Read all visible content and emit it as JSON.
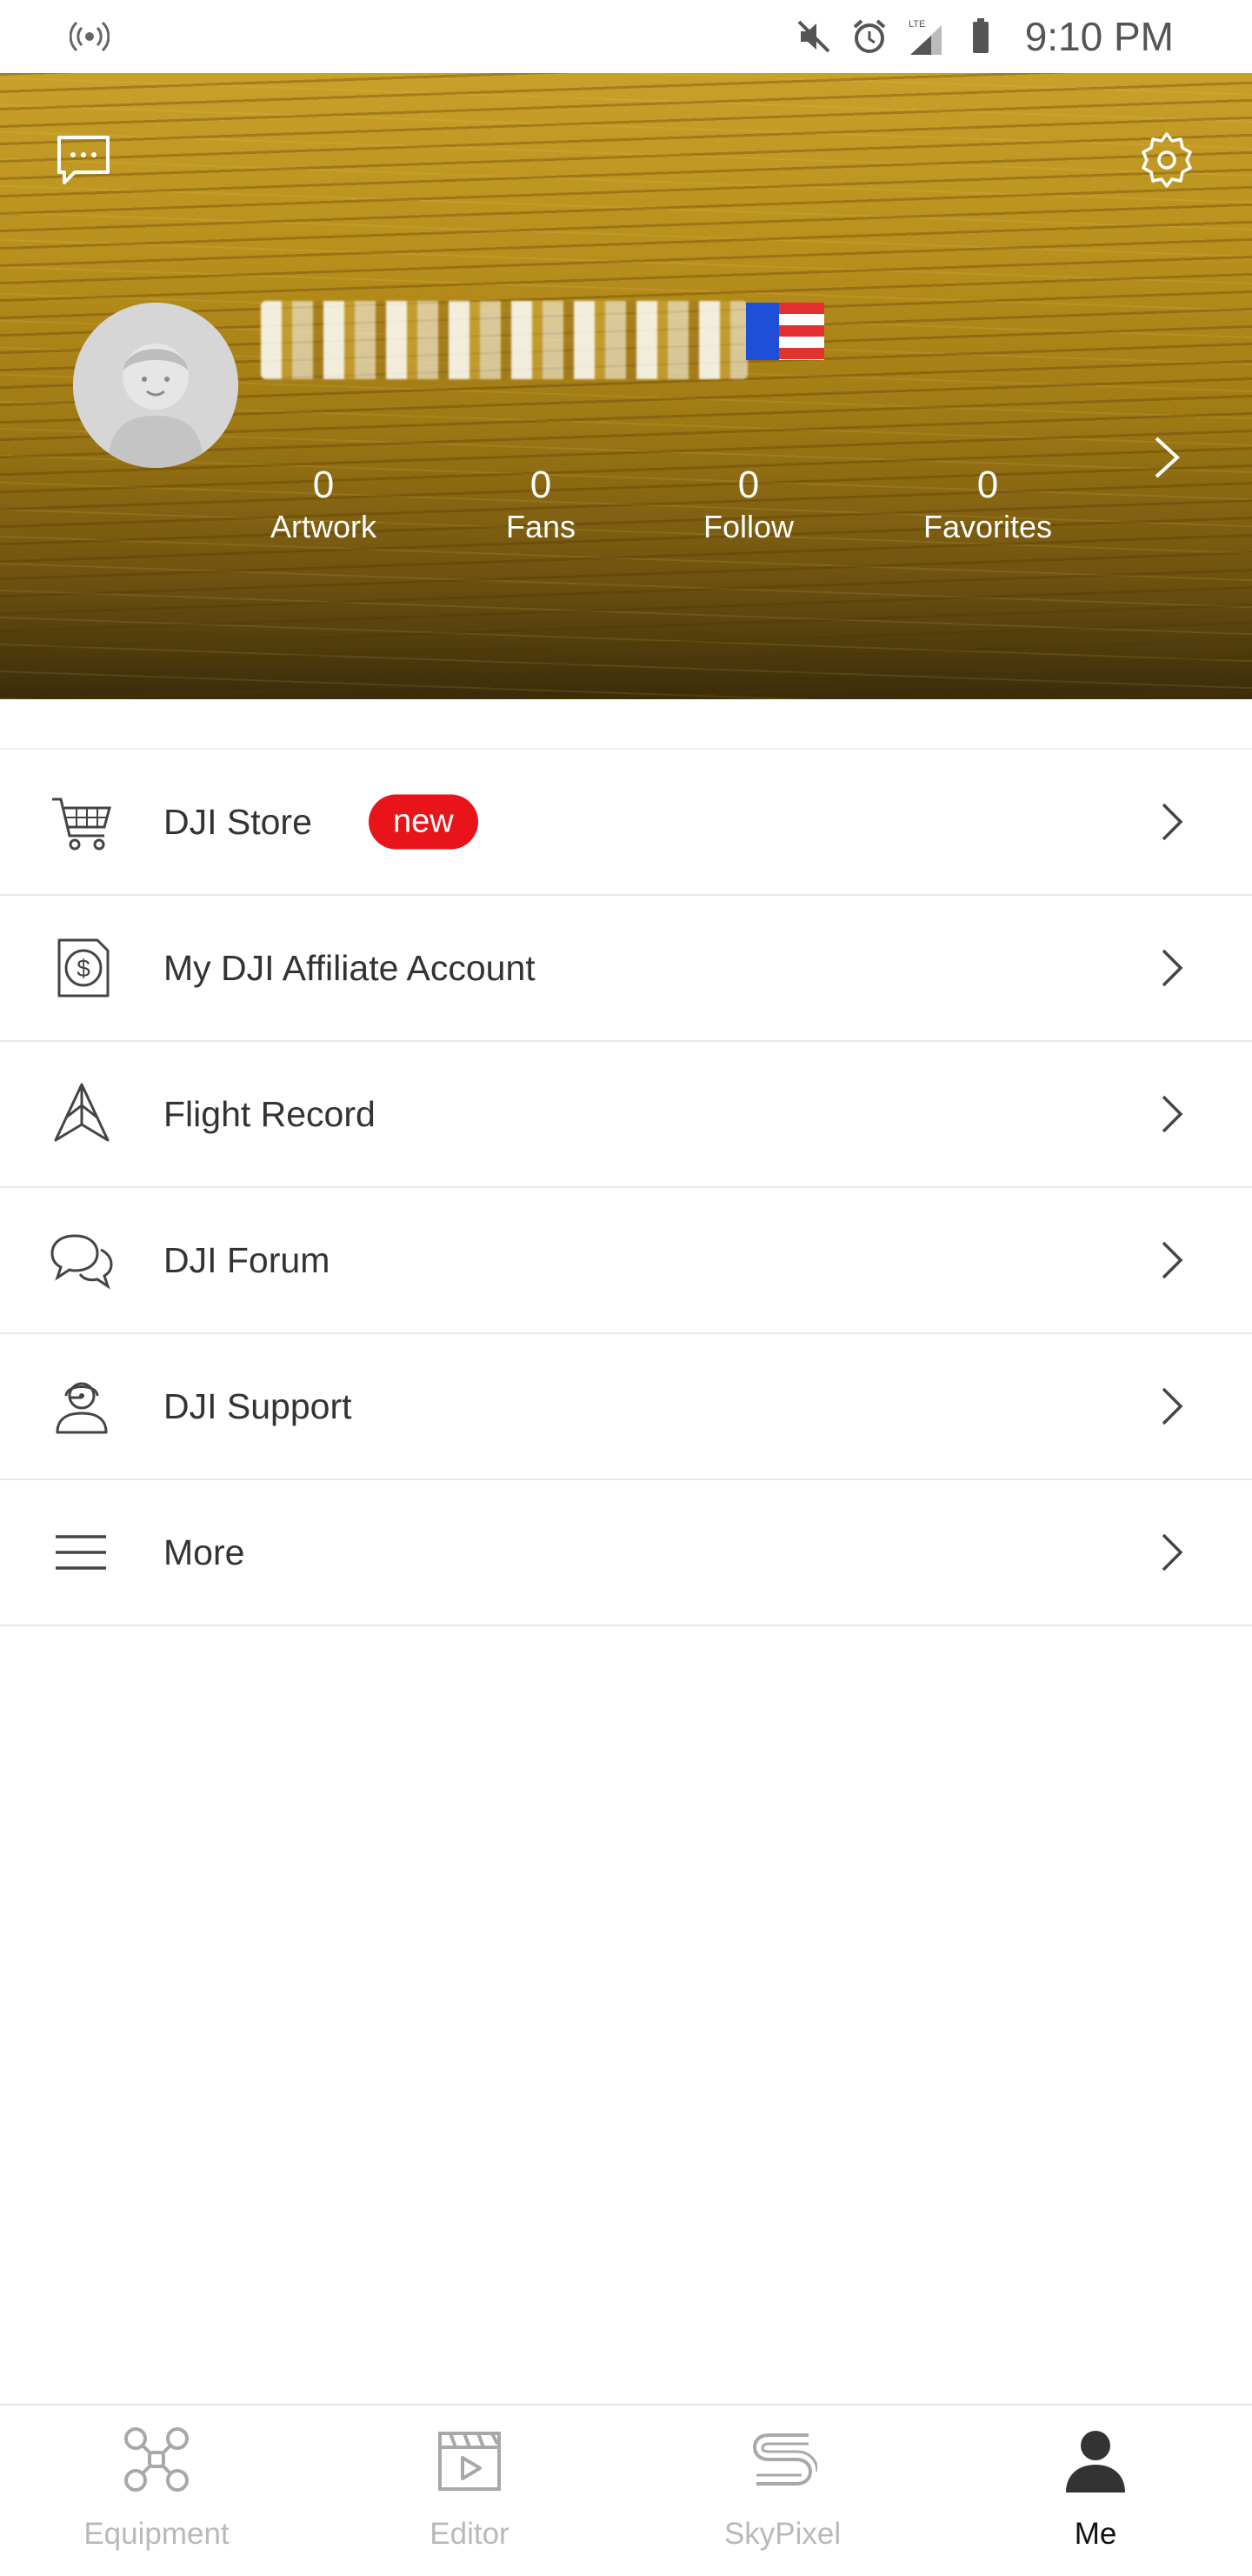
{
  "status_bar": {
    "time": "9:10 PM"
  },
  "header": {
    "stats": [
      {
        "value": "0",
        "label": "Artwork"
      },
      {
        "value": "0",
        "label": "Fans"
      },
      {
        "value": "0",
        "label": "Follow"
      },
      {
        "value": "0",
        "label": "Favorites"
      }
    ]
  },
  "menu": {
    "items": [
      {
        "label": "DJI Store",
        "icon": "cart-icon",
        "badge": "new"
      },
      {
        "label": "My DJI Affiliate Account",
        "icon": "dollar-icon"
      },
      {
        "label": "Flight Record",
        "icon": "flight-record-icon"
      },
      {
        "label": "DJI Forum",
        "icon": "chat-bubbles-icon"
      },
      {
        "label": "DJI Support",
        "icon": "support-agent-icon"
      },
      {
        "label": "More",
        "icon": "hamburger-icon"
      }
    ]
  },
  "bottom_nav": {
    "items": [
      {
        "label": "Equipment",
        "icon": "drone-icon",
        "active": false
      },
      {
        "label": "Editor",
        "icon": "clapperboard-icon",
        "active": false
      },
      {
        "label": "SkyPixel",
        "icon": "skypixel-icon",
        "active": false
      },
      {
        "label": "Me",
        "icon": "person-icon",
        "active": true
      }
    ]
  },
  "colors": {
    "badge": "#e8141a",
    "nav_inactive": "#b9b9b9",
    "nav_active": "#111111",
    "text": "#333333"
  }
}
